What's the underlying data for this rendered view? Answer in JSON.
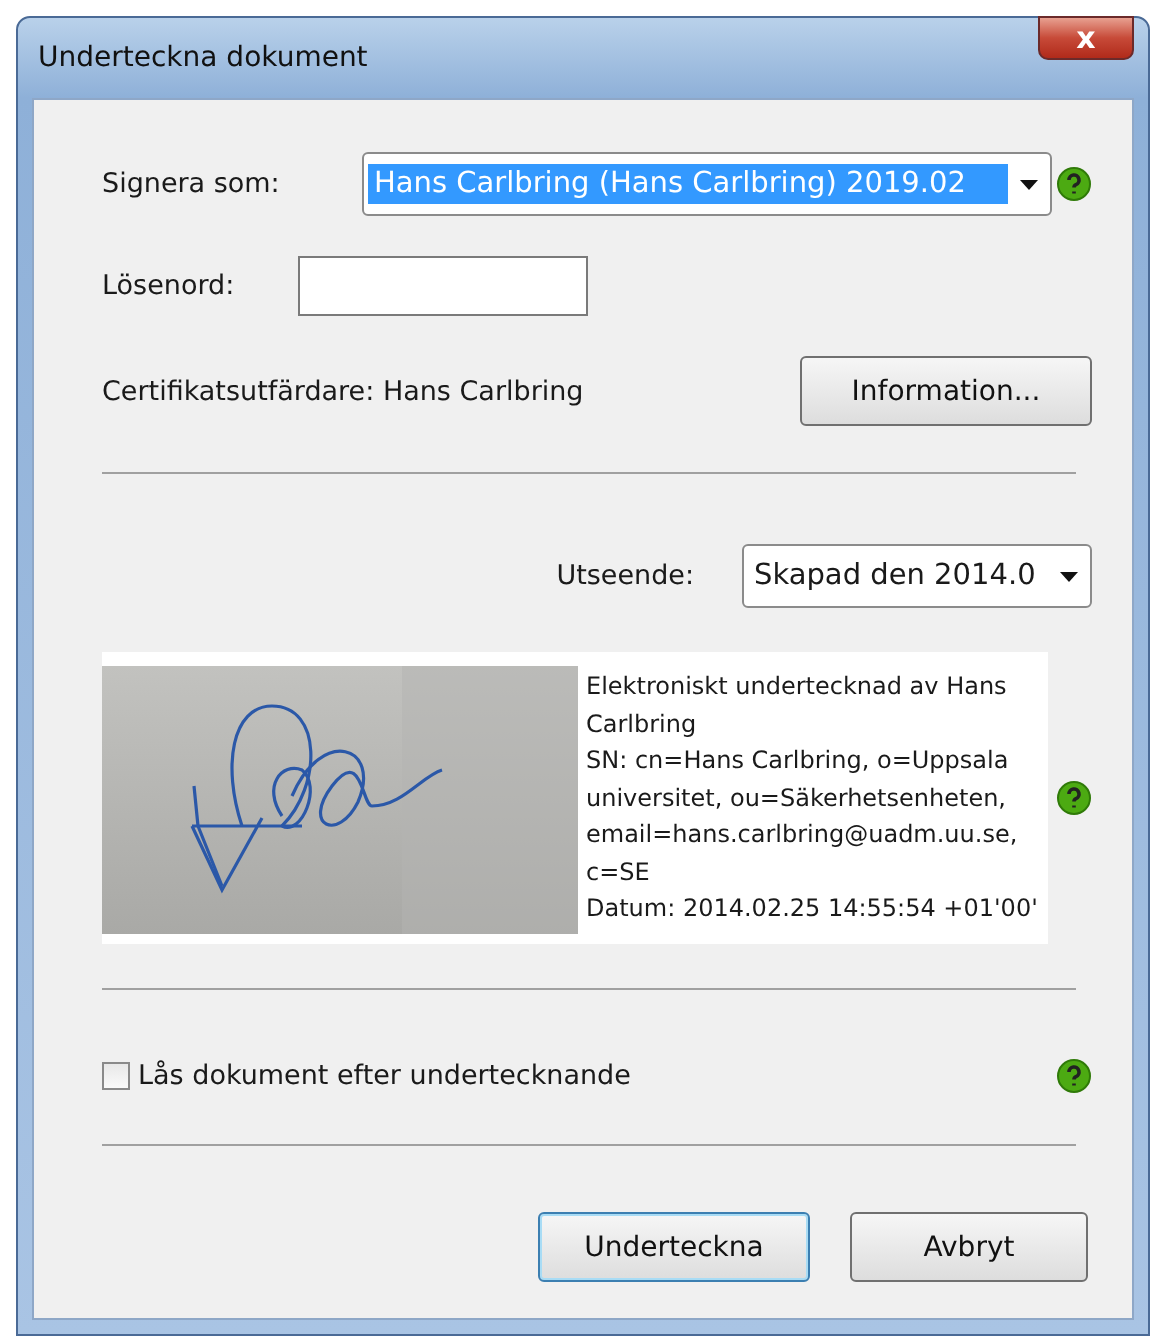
{
  "window": {
    "title": "Underteckna dokument",
    "close_label": "x"
  },
  "sign_as": {
    "label": "Signera som:",
    "value": "Hans Carlbring (Hans Carlbring) 2019.02",
    "selected": true
  },
  "password": {
    "label": "Lösenord:"
  },
  "issuer": {
    "text": "Certifikatsutfärdare: Hans Carlbring",
    "button": "Information..."
  },
  "appearance": {
    "label": "Utseende:",
    "value": "Skapad den 2014.0"
  },
  "preview": {
    "kind": "picture",
    "lines": [
      "Elektroniskt undertecknad av Hans Carlbring",
      "SN: cn=Hans Carlbring, o=Uppsala universitet, ou=Säkerhetsenheten, email=hans.carlbring@uadm.uu.se, c=SE",
      "Datum: 2014.02.25 14:55:54 +01'00'"
    ]
  },
  "lock": {
    "label": "Lås dokument efter undertecknande",
    "checked": false
  },
  "buttons": [
    {
      "label": "Underteckna",
      "default": true
    },
    {
      "label": "Avbryt",
      "default": false
    }
  ]
}
